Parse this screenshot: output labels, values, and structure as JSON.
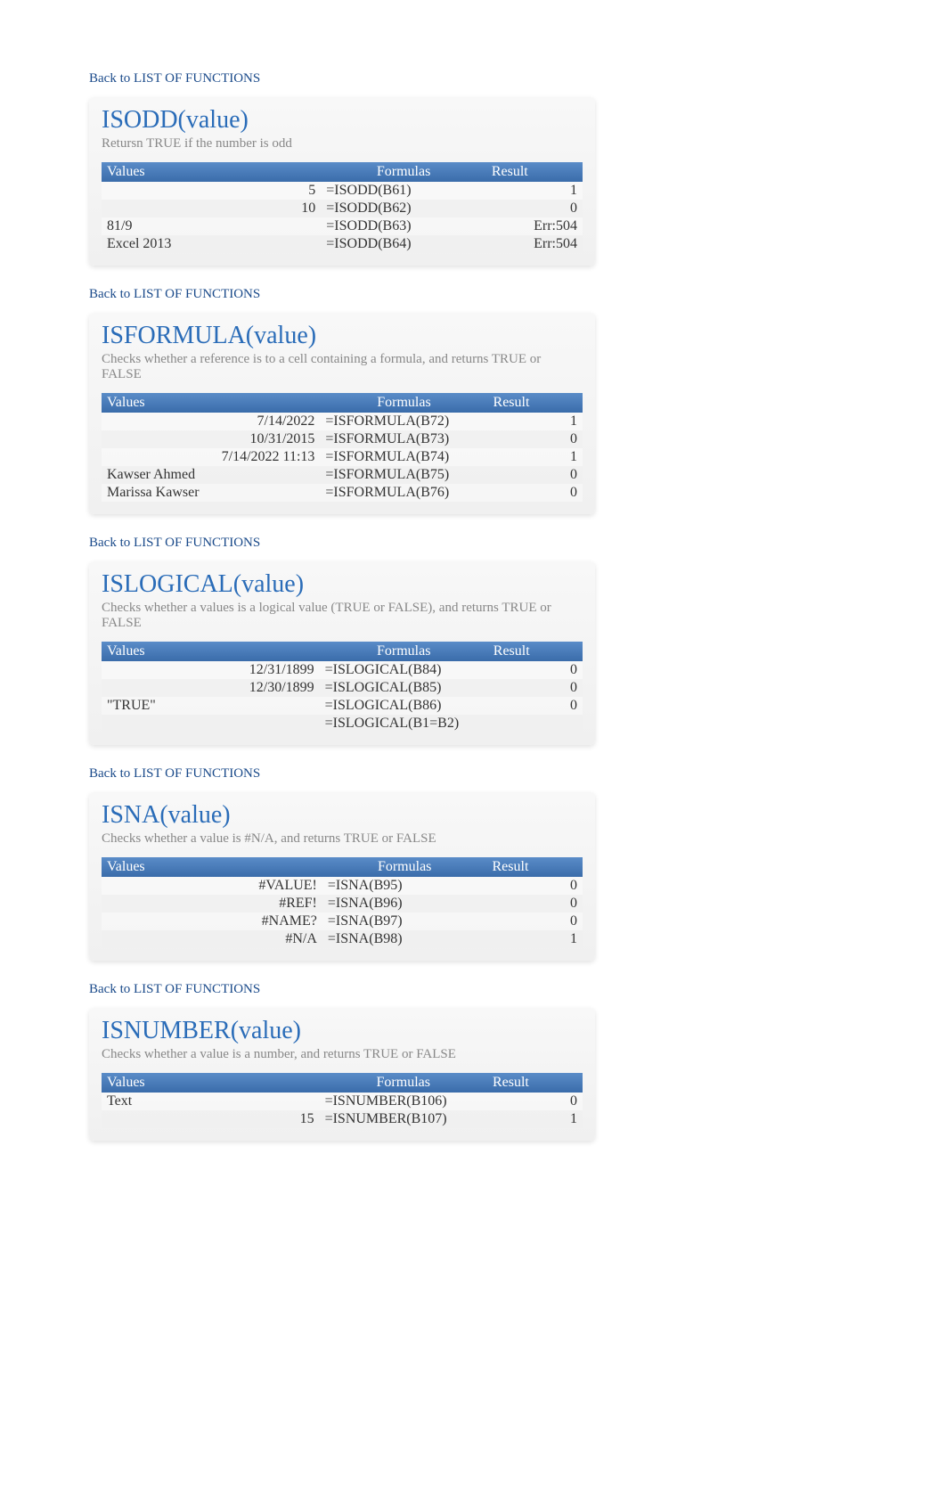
{
  "back_link_label": "Back to LIST OF FUNCTIONS",
  "table_headers": {
    "values": "Values",
    "formulas": "Formulas",
    "result": "Result"
  },
  "sections": [
    {
      "title": "ISODD(value)",
      "desc": "Retursn TRUE if the number is odd",
      "rows": [
        {
          "value": "5",
          "value_align": "right",
          "formula": "=ISODD(B61)",
          "result": "1"
        },
        {
          "value": "10",
          "value_align": "right",
          "formula": "=ISODD(B62)",
          "result": "0"
        },
        {
          "value": "81/9",
          "value_align": "left",
          "formula": "=ISODD(B63)",
          "result": "Err:504"
        },
        {
          "value": "Excel 2013",
          "value_align": "left",
          "formula": "=ISODD(B64)",
          "result": "Err:504"
        }
      ]
    },
    {
      "title": "ISFORMULA(value)",
      "desc": "Checks whether a reference is to a cell containing a formula, and returns TRUE or FALSE",
      "rows": [
        {
          "value": "7/14/2022",
          "value_align": "right",
          "formula": "=ISFORMULA(B72)",
          "result": "1"
        },
        {
          "value": "10/31/2015",
          "value_align": "right",
          "formula": "=ISFORMULA(B73)",
          "result": "0"
        },
        {
          "value": "7/14/2022 11:13",
          "value_align": "right",
          "formula": "=ISFORMULA(B74)",
          "result": "1"
        },
        {
          "value": "Kawser Ahmed",
          "value_align": "left",
          "formula": "=ISFORMULA(B75)",
          "result": "0"
        },
        {
          "value": "Marissa Kawser",
          "value_align": "left",
          "formula": "=ISFORMULA(B76)",
          "result": "0"
        }
      ]
    },
    {
      "title": "ISLOGICAL(value)",
      "desc": "Checks whether a values is a logical value (TRUE or FALSE), and returns TRUE or FALSE",
      "rows": [
        {
          "value": "12/31/1899",
          "value_align": "right",
          "formula": "=ISLOGICAL(B84)",
          "result": "0"
        },
        {
          "value": "12/30/1899",
          "value_align": "right",
          "formula": "=ISLOGICAL(B85)",
          "result": "0"
        },
        {
          "value": "\"TRUE\"",
          "value_align": "left",
          "formula": "=ISLOGICAL(B86)",
          "result": "0"
        },
        {
          "value": "",
          "value_align": "left",
          "formula": "=ISLOGICAL(B1=B2)",
          "result": ""
        }
      ]
    },
    {
      "title": "ISNA(value)",
      "desc": "Checks whether a value is #N/A, and returns TRUE or FALSE",
      "rows": [
        {
          "value": "#VALUE!",
          "value_align": "right",
          "formula": "=ISNA(B95)",
          "result": "0"
        },
        {
          "value": "#REF!",
          "value_align": "right",
          "formula": "=ISNA(B96)",
          "result": "0"
        },
        {
          "value": "#NAME?",
          "value_align": "right",
          "formula": "=ISNA(B97)",
          "result": "0"
        },
        {
          "value": "#N/A",
          "value_align": "right",
          "formula": "=ISNA(B98)",
          "result": "1"
        }
      ]
    },
    {
      "title": "ISNUMBER(value)",
      "desc": "Checks whether a value is a number, and returns TRUE or FALSE",
      "rows": [
        {
          "value": "Text",
          "value_align": "left",
          "formula": "=ISNUMBER(B106)",
          "result": "0"
        },
        {
          "value": "15",
          "value_align": "right",
          "formula": "=ISNUMBER(B107)",
          "result": "1"
        }
      ]
    }
  ]
}
